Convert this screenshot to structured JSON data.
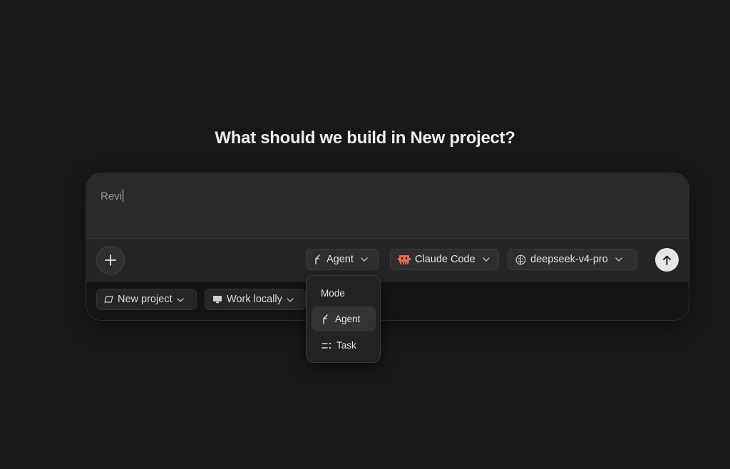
{
  "heading": "What should we build in New project?",
  "composer": {
    "input_value": "Revi",
    "toolbar": {
      "mode_label": "Agent",
      "agent_label": "Claude Code",
      "model_label": "deepseek-v4-pro"
    },
    "bottom": {
      "project_label": "New project",
      "location_label": "Work locally"
    }
  },
  "mode_menu": {
    "title": "Mode",
    "items": [
      {
        "label": "Agent",
        "icon": "agent-icon",
        "selected": true
      },
      {
        "label": "Task",
        "icon": "task-icon",
        "selected": false
      }
    ]
  },
  "colors": {
    "background": "#181818",
    "input_area": "#2a2a2a",
    "send_button": "#e6e6e6",
    "claude_code_icon": "#e06a4f"
  }
}
